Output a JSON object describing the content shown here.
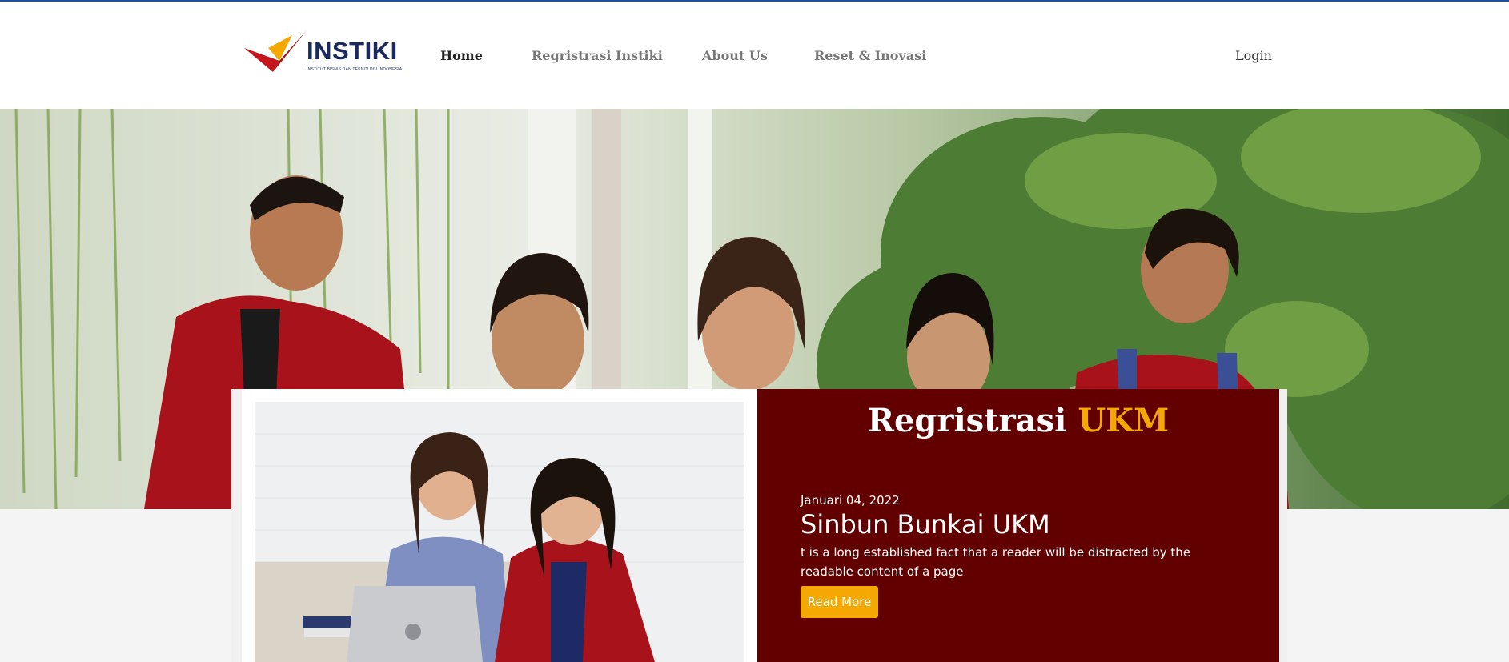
{
  "brand": {
    "name": "INSTIKI",
    "tagline": "INSTITUT BISNIS DAN TEKNOLOGI INDONESIA",
    "primary_color": "#1a2a5e",
    "accent_red": "#c4161c",
    "accent_yellow": "#f5a800"
  },
  "nav": {
    "items": [
      {
        "label": "Home",
        "active": true
      },
      {
        "label": "Regristrasi Instiki",
        "active": false
      },
      {
        "label": "About Us",
        "active": false
      },
      {
        "label": "Reset & Inovasi",
        "active": false
      }
    ],
    "login_label": "Login"
  },
  "card": {
    "title_main": "Regristrasi",
    "title_accent": "UKM",
    "background_color": "#620000",
    "post": {
      "date": "Januari 04, 2022",
      "heading": "Sinbun Bunkai UKM",
      "body": "t is a long established fact that a reader will be distracted by the readable content of a page",
      "button_label": "Read More"
    }
  }
}
